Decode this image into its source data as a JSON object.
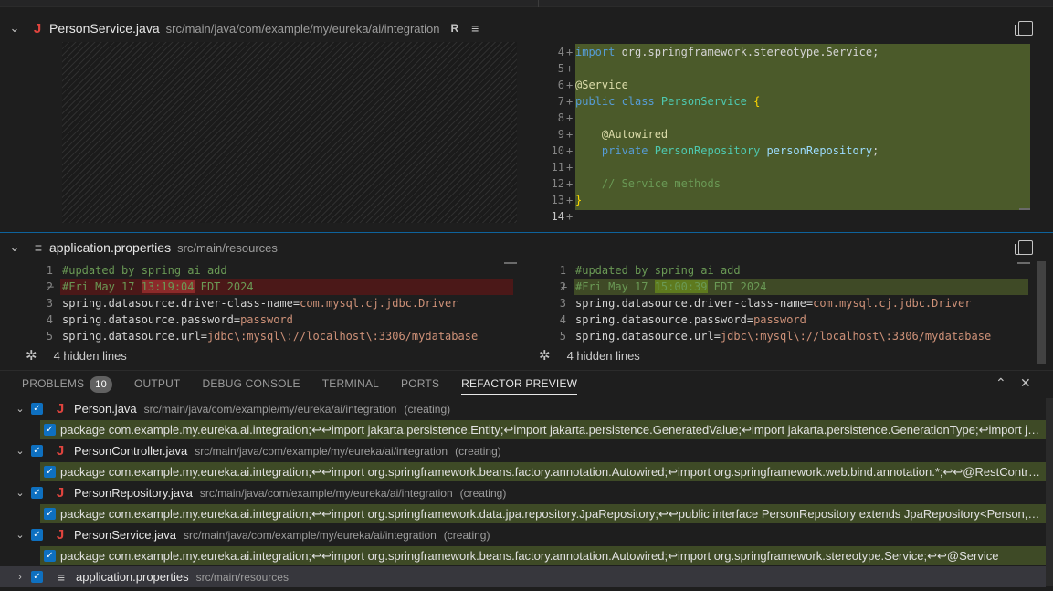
{
  "diff1": {
    "file_name": "PersonService.java",
    "path": "src/main/java/com/example/my/eureka/ai/integration",
    "badge": "R",
    "lines": [
      {
        "n": "4",
        "marker": "+",
        "tokens": [
          [
            "kw",
            "import"
          ],
          [
            "pl",
            " org.springframework.stereotype.Service;"
          ]
        ]
      },
      {
        "n": "5",
        "marker": "+",
        "tokens": []
      },
      {
        "n": "6",
        "marker": "+",
        "tokens": [
          [
            "an",
            "@Service"
          ]
        ]
      },
      {
        "n": "7",
        "marker": "+",
        "tokens": [
          [
            "kw",
            "public class "
          ],
          [
            "ty",
            "PersonService"
          ],
          [
            "pl",
            " "
          ],
          [
            "br",
            "{"
          ]
        ]
      },
      {
        "n": "8",
        "marker": "+",
        "tokens": []
      },
      {
        "n": "9",
        "marker": "+",
        "tokens": [
          [
            "pl",
            "    "
          ],
          [
            "an",
            "@Autowired"
          ]
        ]
      },
      {
        "n": "10",
        "marker": "+",
        "tokens": [
          [
            "pl",
            "    "
          ],
          [
            "kw",
            "private "
          ],
          [
            "ty",
            "PersonRepository"
          ],
          [
            "pl",
            " "
          ],
          [
            "id",
            "personRepository"
          ],
          [
            "pl",
            ";"
          ]
        ]
      },
      {
        "n": "11",
        "marker": "+",
        "tokens": []
      },
      {
        "n": "12",
        "marker": "+",
        "tokens": [
          [
            "pl",
            "    "
          ],
          [
            "cm",
            "// Service methods"
          ]
        ]
      },
      {
        "n": "13",
        "marker": "+",
        "tokens": [
          [
            "br",
            "}"
          ]
        ]
      },
      {
        "n": "14",
        "marker": "+",
        "tokens": []
      }
    ]
  },
  "diff2": {
    "file_name": "application.properties",
    "path": "src/main/resources",
    "left_lines": [
      {
        "n": "1",
        "marker": "",
        "tokens": [
          [
            "cm",
            "#updated by spring ai add"
          ]
        ]
      },
      {
        "n": "2",
        "marker": "−",
        "tokens": [
          [
            "cm",
            "#Fri May 17 "
          ],
          [
            "cmh",
            "13:19:04"
          ],
          [
            "cm",
            " EDT 2024"
          ]
        ]
      },
      {
        "n": "3",
        "marker": "",
        "tokens": [
          [
            "pl",
            "spring.datasource.driver-class-name="
          ],
          [
            "str",
            "com.mysql.cj.jdbc.Driver"
          ]
        ]
      },
      {
        "n": "4",
        "marker": "",
        "tokens": [
          [
            "pl",
            "spring.datasource.password="
          ],
          [
            "str",
            "password"
          ]
        ]
      },
      {
        "n": "5",
        "marker": "",
        "tokens": [
          [
            "pl",
            "spring.datasource.url="
          ],
          [
            "str",
            "jdbc\\:mysql\\://localhost\\:3306/mydatabase"
          ]
        ]
      }
    ],
    "right_lines": [
      {
        "n": "1",
        "marker": "",
        "tokens": [
          [
            "cm",
            "#updated by spring ai add"
          ]
        ]
      },
      {
        "n": "2",
        "marker": "+",
        "tokens": [
          [
            "cm",
            "#Fri May 17 "
          ],
          [
            "cmh",
            "15:00:39"
          ],
          [
            "cm",
            " EDT 2024"
          ]
        ]
      },
      {
        "n": "3",
        "marker": "",
        "tokens": [
          [
            "pl",
            "spring.datasource.driver-class-name="
          ],
          [
            "str",
            "com.mysql.cj.jdbc.Driver"
          ]
        ]
      },
      {
        "n": "4",
        "marker": "",
        "tokens": [
          [
            "pl",
            "spring.datasource.password="
          ],
          [
            "str",
            "password"
          ]
        ]
      },
      {
        "n": "5",
        "marker": "",
        "tokens": [
          [
            "pl",
            "spring.datasource.url="
          ],
          [
            "str",
            "jdbc\\:mysql\\://localhost\\:3306/mydatabase"
          ]
        ]
      }
    ],
    "hidden_left": "4 hidden lines",
    "hidden_right": "4 hidden lines"
  },
  "panel": {
    "tabs": [
      {
        "label": "PROBLEMS",
        "badge": "10"
      },
      {
        "label": "OUTPUT"
      },
      {
        "label": "DEBUG CONSOLE"
      },
      {
        "label": "TERMINAL"
      },
      {
        "label": "PORTS"
      },
      {
        "label": "REFACTOR PREVIEW",
        "active": true
      }
    ]
  },
  "refactor": {
    "items": [
      {
        "name": "Person.java",
        "path": "src/main/java/com/example/my/eureka/ai/integration",
        "state": "(creating)",
        "type": "java",
        "preview": "package com.example.my.eureka.ai.integration;↩↩import jakarta.persistence.Entity;↩import jakarta.persistence.GeneratedValue;↩import jakarta.persistence.GenerationType;↩import jakarta.persistence.Id;"
      },
      {
        "name": "PersonController.java",
        "path": "src/main/java/com/example/my/eureka/ai/integration",
        "state": "(creating)",
        "type": "java",
        "preview": "package com.example.my.eureka.ai.integration;↩↩import org.springframework.beans.factory.annotation.Autowired;↩import org.springframework.web.bind.annotation.*;↩↩@RestController"
      },
      {
        "name": "PersonRepository.java",
        "path": "src/main/java/com/example/my/eureka/ai/integration",
        "state": "(creating)",
        "type": "java",
        "preview": "package com.example.my.eureka.ai.integration;↩↩import org.springframework.data.jpa.repository.JpaRepository;↩↩public interface PersonRepository extends JpaRepository<Person, Long> {"
      },
      {
        "name": "PersonService.java",
        "path": "src/main/java/com/example/my/eureka/ai/integration",
        "state": "(creating)",
        "type": "java",
        "preview": "package com.example.my.eureka.ai.integration;↩↩import org.springframework.beans.factory.annotation.Autowired;↩import org.springframework.stereotype.Service;↩↩@Service"
      },
      {
        "name": "application.properties",
        "path": "src/main/resources",
        "state": "",
        "type": "props",
        "preview": ""
      }
    ]
  }
}
